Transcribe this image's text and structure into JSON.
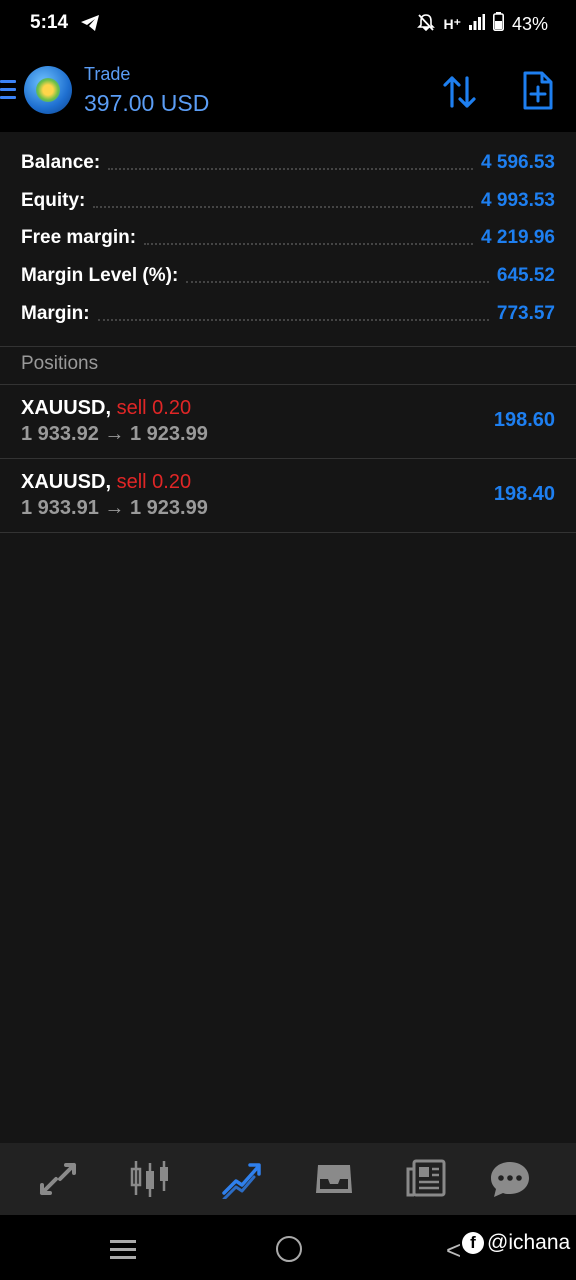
{
  "status_bar": {
    "time": "5:14",
    "icons": [
      "telegram-icon",
      "bell-off-icon",
      "signal-icon",
      "battery-icon"
    ],
    "network": "H⁺",
    "battery": "43%"
  },
  "header": {
    "title": "Trade",
    "value": "397.00 USD",
    "icons": [
      "menu-icon",
      "app-logo",
      "sort-icon",
      "new-order-icon"
    ]
  },
  "account": {
    "rows": [
      {
        "label": "Balance:",
        "value": "4 596.53"
      },
      {
        "label": "Equity:",
        "value": "4 993.53"
      },
      {
        "label": "Free margin:",
        "value": "4 219.96"
      },
      {
        "label": "Margin Level (%):",
        "value": "645.52"
      },
      {
        "label": "Margin:",
        "value": "773.57"
      }
    ]
  },
  "positions": {
    "heading": "Positions",
    "items": [
      {
        "symbol": "XAUUSD,",
        "side": "sell 0.20",
        "prices": "1 933.92 → 1 923.99",
        "profit": "198.60"
      },
      {
        "symbol": "XAUUSD,",
        "side": "sell 0.20",
        "prices": "1 933.91 → 1 923.99",
        "profit": "198.40"
      }
    ]
  },
  "tabs": [
    "quotes-icon",
    "chart-icon",
    "trade-icon",
    "history-icon",
    "news-icon",
    "messages-icon"
  ],
  "colors": {
    "accent": "#1e7ff0",
    "sell": "#e02626",
    "background": "#151515"
  },
  "watermark": "@ichana"
}
